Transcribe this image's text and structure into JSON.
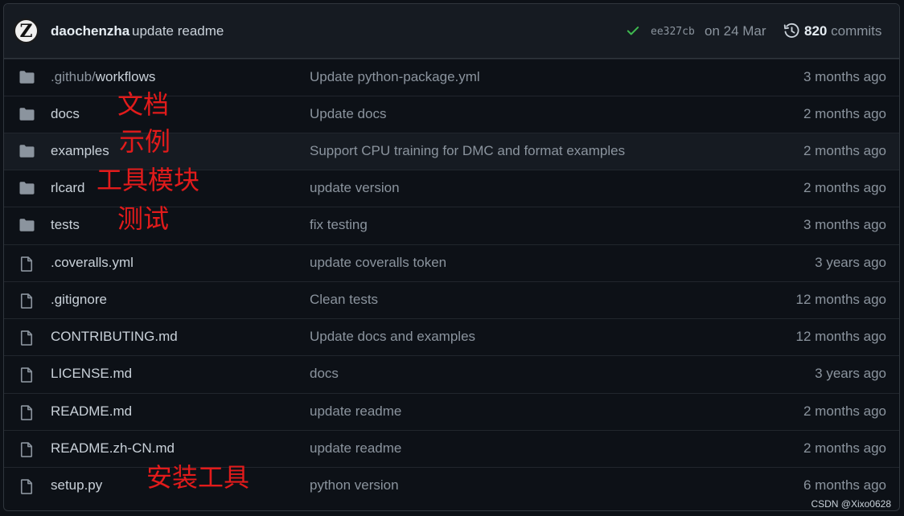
{
  "header": {
    "avatar_letter": "Z",
    "author": "daochenzha",
    "message": "update readme",
    "status_color": "#3fb950",
    "sha": "ee327cb",
    "date": "on 24 Mar",
    "commit_count": "820",
    "commits_label": "commits"
  },
  "files": [
    {
      "type": "folder",
      "name_prefix": ".github/",
      "name": "workflows",
      "message": "Update python-package.yml",
      "age": "3 months ago"
    },
    {
      "type": "folder",
      "name_prefix": "",
      "name": "docs",
      "message": "Update docs",
      "age": "2 months ago",
      "annotation": "文档"
    },
    {
      "type": "folder",
      "name_prefix": "",
      "name": "examples",
      "message": "Support CPU training for DMC and format examples",
      "age": "2 months ago",
      "annotation": "示例"
    },
    {
      "type": "folder",
      "name_prefix": "",
      "name": "rlcard",
      "message": "update version",
      "age": "2 months ago",
      "annotation": "工具模块"
    },
    {
      "type": "folder",
      "name_prefix": "",
      "name": "tests",
      "message": "fix testing",
      "age": "3 months ago",
      "annotation": "测试"
    },
    {
      "type": "file",
      "name_prefix": "",
      "name": ".coveralls.yml",
      "message": "update coveralls token",
      "age": "3 years ago"
    },
    {
      "type": "file",
      "name_prefix": "",
      "name": ".gitignore",
      "message": "Clean tests",
      "age": "12 months ago"
    },
    {
      "type": "file",
      "name_prefix": "",
      "name": "CONTRIBUTING.md",
      "message": "Update docs and examples",
      "age": "12 months ago"
    },
    {
      "type": "file",
      "name_prefix": "",
      "name": "LICENSE.md",
      "message": "docs",
      "age": "3 years ago"
    },
    {
      "type": "file",
      "name_prefix": "",
      "name": "README.md",
      "message": "update readme",
      "age": "2 months ago"
    },
    {
      "type": "file",
      "name_prefix": "",
      "name": "README.zh-CN.md",
      "message": "update readme",
      "age": "2 months ago"
    },
    {
      "type": "file",
      "name_prefix": "",
      "name": "setup.py",
      "message": "python version",
      "age": "6 months ago",
      "annotation": "安装工具"
    }
  ],
  "annotation_color": "#e21b1b",
  "watermark": "CSDN @Xixo0628"
}
